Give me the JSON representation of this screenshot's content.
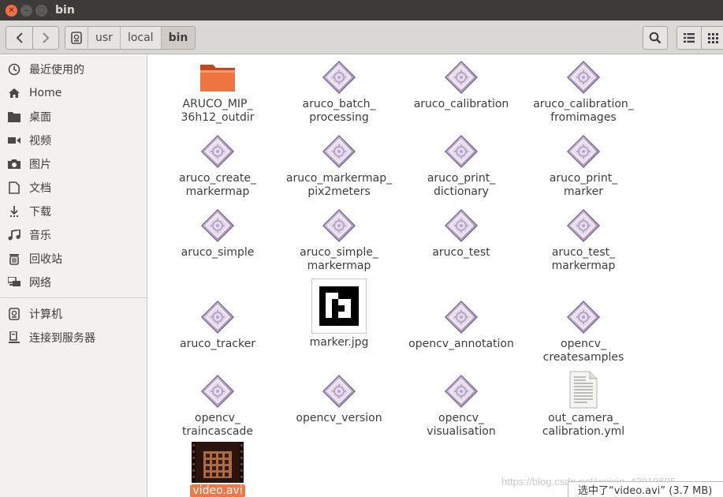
{
  "window": {
    "title": "bin"
  },
  "toolbar": {
    "path": [
      "usr",
      "local",
      "bin"
    ]
  },
  "sidebar": {
    "places": [
      {
        "label": "最近使用的",
        "icon": "recent-icon"
      },
      {
        "label": "Home",
        "icon": "home-icon"
      },
      {
        "label": "桌面",
        "icon": "desktop-folder-icon"
      },
      {
        "label": "视频",
        "icon": "video-icon"
      },
      {
        "label": "图片",
        "icon": "camera-icon"
      },
      {
        "label": "文档",
        "icon": "document-icon"
      },
      {
        "label": "下载",
        "icon": "download-icon"
      },
      {
        "label": "音乐",
        "icon": "music-icon"
      },
      {
        "label": "回收站",
        "icon": "trash-icon"
      },
      {
        "label": "网络",
        "icon": "network-icon"
      }
    ],
    "devices": [
      {
        "label": "计算机",
        "icon": "computer-icon"
      },
      {
        "label": "连接到服务器",
        "icon": "server-icon"
      }
    ]
  },
  "files": [
    {
      "label": "ARUCO_MIP_\n36h12_outdir",
      "type": "folder"
    },
    {
      "label": "aruco_batch_\nprocessing",
      "type": "executable"
    },
    {
      "label": "aruco_calibration",
      "type": "executable"
    },
    {
      "label": "aruco_calibration_\nfromimages",
      "type": "executable"
    },
    {
      "label": "aruco_create_\nmarkermap",
      "type": "executable"
    },
    {
      "label": "aruco_markermap_\npix2meters",
      "type": "executable"
    },
    {
      "label": "aruco_print_\ndictionary",
      "type": "executable"
    },
    {
      "label": "aruco_print_\nmarker",
      "type": "executable"
    },
    {
      "label": "aruco_simple",
      "type": "executable"
    },
    {
      "label": "aruco_simple_\nmarkermap",
      "type": "executable"
    },
    {
      "label": "aruco_test",
      "type": "executable"
    },
    {
      "label": "aruco_test_\nmarkermap",
      "type": "executable"
    },
    {
      "label": "aruco_tracker",
      "type": "executable"
    },
    {
      "label": "marker.jpg",
      "type": "image"
    },
    {
      "label": "opencv_annotation",
      "type": "executable"
    },
    {
      "label": "opencv_\ncreatesamples",
      "type": "executable"
    },
    {
      "label": "opencv_\ntraincascade",
      "type": "executable"
    },
    {
      "label": "opencv_version",
      "type": "executable"
    },
    {
      "label": "opencv_\nvisualisation",
      "type": "executable"
    },
    {
      "label": "out_camera_\ncalibration.yml",
      "type": "text"
    },
    {
      "label": "video.avi",
      "type": "video",
      "selected": true
    }
  ],
  "status": {
    "text": "选中了“video.avi” (3.7 MB)"
  },
  "watermark": "https://blog.csdn.net/weixin_43919695",
  "colors": {
    "accent": "#f07746",
    "titlebar": "#3c3b37",
    "folder": "#e9663a"
  }
}
